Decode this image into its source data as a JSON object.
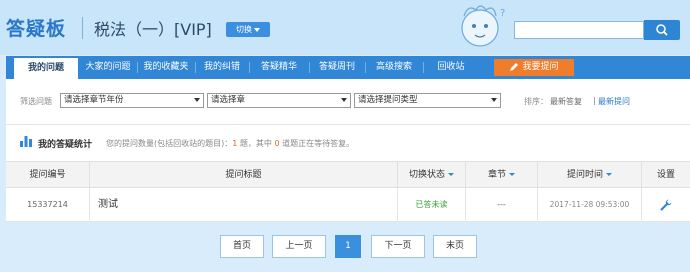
{
  "header": {
    "brand": "答疑板",
    "course": "税法（一）[VIP]",
    "switch_label": "切换",
    "search_placeholder": ""
  },
  "nav": {
    "items": [
      {
        "label": "我的问题",
        "active": true
      },
      {
        "label": "大家的问题",
        "active": false
      },
      {
        "label": "我的收藏夹",
        "active": false
      },
      {
        "label": "我的纠错",
        "active": false
      },
      {
        "label": "答疑精华",
        "active": false
      },
      {
        "label": "答疑周刊",
        "active": false
      },
      {
        "label": "高级搜索",
        "active": false
      },
      {
        "label": "回收站",
        "active": false
      }
    ],
    "ask_label": "我要提问"
  },
  "filter": {
    "label": "筛选问题",
    "select1": "请选择章节年份",
    "select2": "请选择章",
    "select3": "请选择提问类型",
    "sort_label": "排序：",
    "sort_options": [
      "最新答复",
      "最新提问"
    ]
  },
  "stats": {
    "title": "我的答疑统计",
    "text_a": "您的提问数量(包括回收站的题目)：",
    "count": "1",
    "text_b": " 题，其中 ",
    "pending": "0",
    "text_c": " 道题正在等待答复。"
  },
  "table": {
    "headers": [
      "提问编号",
      "提问标题",
      "切换状态",
      "章节",
      "提问时间",
      "设置"
    ],
    "rows": [
      {
        "id": "15337214",
        "title": "测试",
        "status": "已答未读",
        "chapter": "---",
        "time": "2017-11-28 09:53:00"
      }
    ]
  },
  "pager": {
    "first": "首页",
    "prev": "上一页",
    "current": "1",
    "next": "下一页",
    "last": "末页"
  },
  "colors": {
    "accent": "#3186d6",
    "ask": "#f07d2b",
    "status_green": "#3aa03a"
  }
}
